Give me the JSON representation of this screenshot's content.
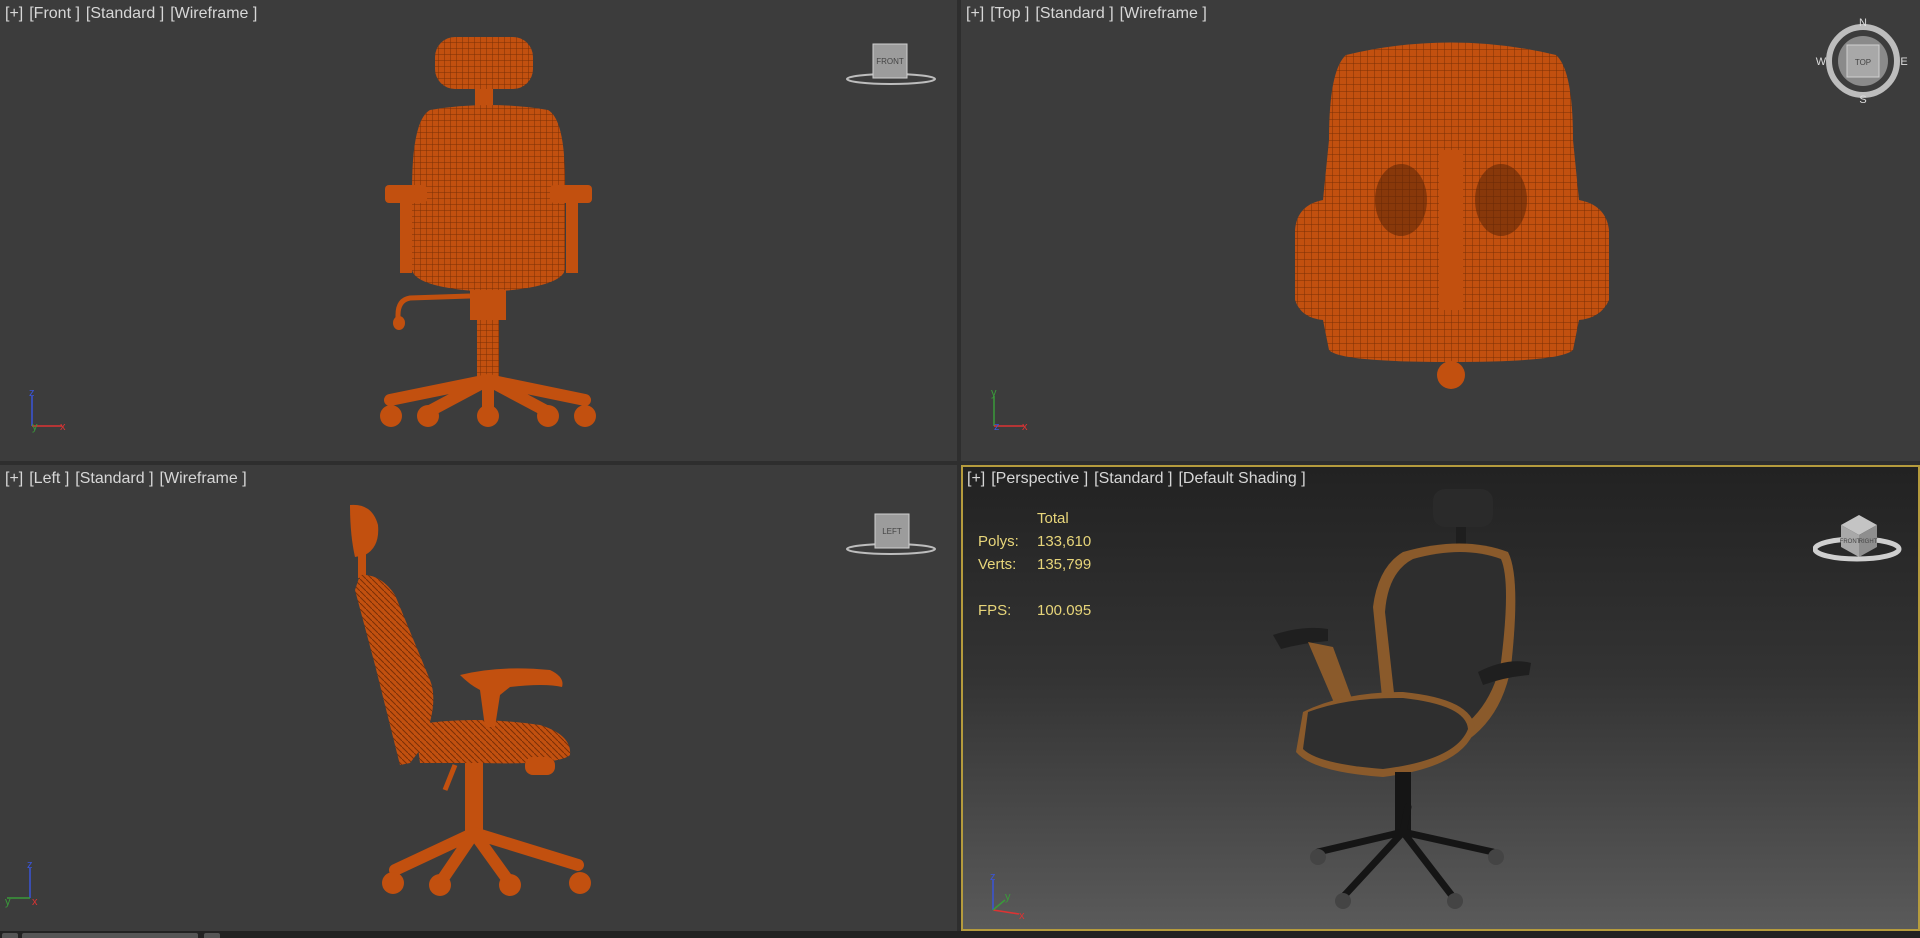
{
  "viewports": {
    "front": {
      "labels": [
        "[+]",
        "[Front ]",
        "[Standard ]",
        "[Wireframe ]"
      ],
      "viewcube_label": "FRONT"
    },
    "top": {
      "labels": [
        "[+]",
        "[Top ]",
        "[Standard ]",
        "[Wireframe ]"
      ],
      "viewcube_label": "TOP",
      "compass": {
        "n": "N",
        "s": "S",
        "e": "E",
        "w": "W"
      }
    },
    "left": {
      "labels": [
        "[+]",
        "[Left ]",
        "[Standard ]",
        "[Wireframe ]"
      ],
      "viewcube_label": "LEFT"
    },
    "perspective": {
      "labels": [
        "[+]",
        "[Perspective ]",
        "[Standard ]",
        "[Default Shading ]"
      ],
      "viewcube_labels": [
        "FRONT",
        "RIGHT"
      ]
    }
  },
  "stats": {
    "total_label": "Total",
    "polys_label": "Polys:",
    "polys_value": "133,610",
    "verts_label": "Verts:",
    "verts_value": "135,799",
    "fps_label": "FPS:",
    "fps_value": "100.095"
  },
  "axis_labels": {
    "x": "x",
    "y": "y",
    "z": "z"
  },
  "colors": {
    "wireframe": "#c2500f",
    "wire_lines": "#7a2f06",
    "active_border": "#b59b3d",
    "stats_text": "#e7d57a",
    "label_text": "#d7d7d7"
  }
}
